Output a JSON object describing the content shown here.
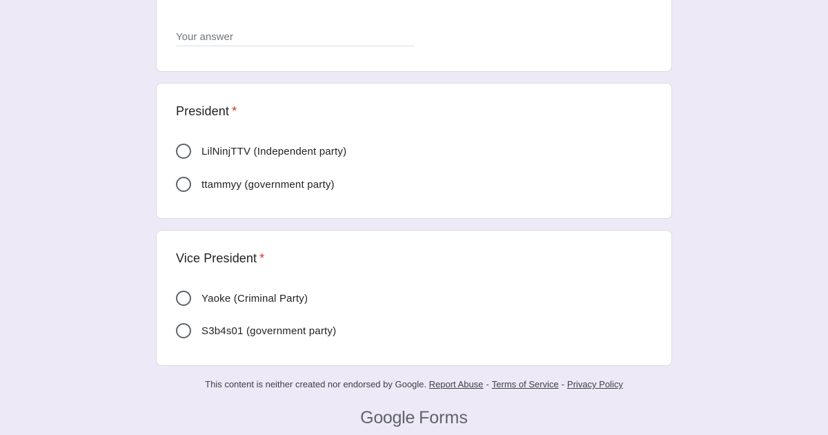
{
  "top_card": {
    "answer_placeholder": "Your answer"
  },
  "questions": [
    {
      "title": "President",
      "required_mark": "*",
      "options": [
        {
          "label": "LilNinjTTV (Independent party)"
        },
        {
          "label": "ttammyy (government party)"
        }
      ]
    },
    {
      "title": "Vice President",
      "required_mark": "*",
      "options": [
        {
          "label": "Yaoke (Criminal Party)"
        },
        {
          "label": "S3b4s01 (government party)"
        }
      ]
    }
  ],
  "footer": {
    "disclaimer": "This content is neither created nor endorsed by Google.",
    "report_abuse": "Report Abuse",
    "separator": "-",
    "terms": "Terms of Service",
    "privacy": "Privacy Policy"
  },
  "brand": {
    "google": "Google",
    "forms": "Forms"
  },
  "colors": {
    "background": "#ede9f6",
    "required": "#d93025",
    "radio_border": "#5f6368"
  }
}
